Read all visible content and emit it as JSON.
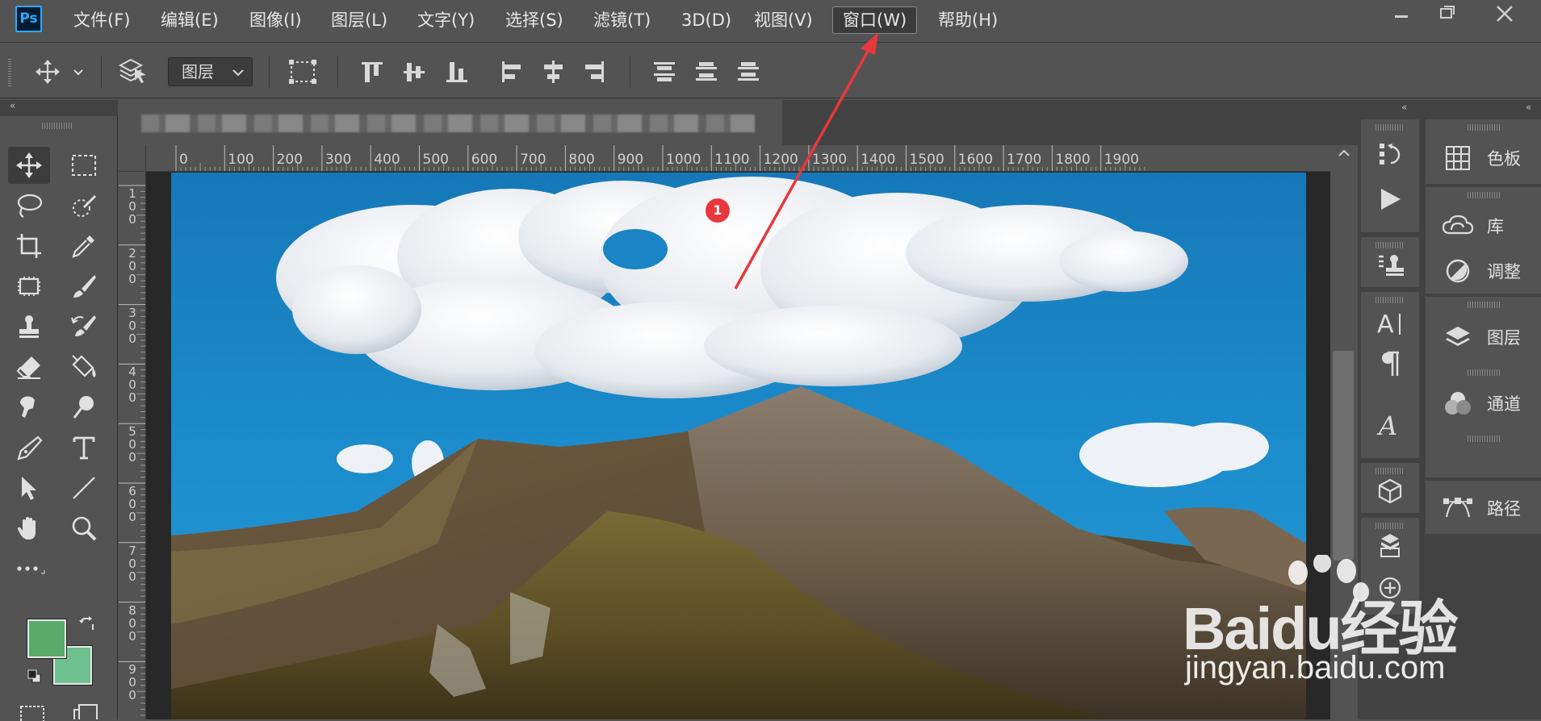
{
  "app": {
    "logo_text": "Ps"
  },
  "menu": {
    "items": [
      "文件(F)",
      "编辑(E)",
      "图像(I)",
      "图层(L)",
      "文字(Y)",
      "选择(S)",
      "滤镜(T)",
      "3D(D)",
      "视图(V)",
      "窗口(W)",
      "帮助(H)"
    ],
    "active_item": "窗口(W)"
  },
  "options_bar": {
    "auto_select_target": "图层"
  },
  "ruler": {
    "top_labels": [
      "0",
      "100",
      "200",
      "300",
      "400",
      "500",
      "600",
      "700",
      "800",
      "900",
      "1000",
      "1100",
      "1200",
      "1300",
      "1400",
      "1500",
      "1600",
      "1700",
      "1800",
      "1900"
    ],
    "left_labels": [
      "1 0 0",
      "2 0 0",
      "3 0 0",
      "4 0 0",
      "5 0 0",
      "6 0 0",
      "7 0 0",
      "8 0 0",
      "9 0 0"
    ]
  },
  "panels": {
    "items": [
      {
        "label": "色板",
        "icon": "swatches-icon"
      },
      {
        "label": "库",
        "icon": "libraries-icon"
      },
      {
        "label": "调整",
        "icon": "adjustments-icon"
      },
      {
        "label": "图层",
        "icon": "layers-icon"
      },
      {
        "label": "通道",
        "icon": "channels-icon"
      },
      {
        "label": "路径",
        "icon": "paths-icon"
      }
    ]
  },
  "annotation": {
    "badge_number": "1"
  },
  "colors": {
    "foreground": "#5aab6b",
    "background": "#6fc08f",
    "annotation_red": "#e8383d",
    "ui_background": "#535353"
  },
  "watermark": {
    "brand": "Baidu经验",
    "url": "jingyan.baidu.com"
  }
}
